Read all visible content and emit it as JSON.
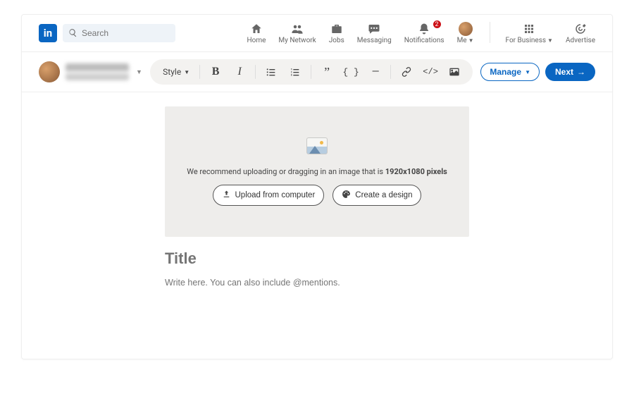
{
  "header": {
    "logo_text": "in",
    "search_placeholder": "Search",
    "nav": [
      {
        "key": "home",
        "label": "Home"
      },
      {
        "key": "network",
        "label": "My Network"
      },
      {
        "key": "jobs",
        "label": "Jobs"
      },
      {
        "key": "messaging",
        "label": "Messaging"
      },
      {
        "key": "notifications",
        "label": "Notifications",
        "badge": "2"
      },
      {
        "key": "me",
        "label": "Me",
        "dropdown": true
      },
      {
        "key": "business",
        "label": "For Business",
        "dropdown": true
      },
      {
        "key": "advertise",
        "label": "Advertise"
      }
    ]
  },
  "subbar": {
    "toolbar": {
      "style_label": "Style"
    },
    "manage_label": "Manage",
    "next_label": "Next"
  },
  "cover": {
    "recommend_prefix": "We recommend uploading or dragging in an image that is ",
    "recommend_bold": "1920x1080 pixels",
    "upload_label": "Upload from computer",
    "design_label": "Create a design"
  },
  "article": {
    "title_placeholder": "Title",
    "body_placeholder": "Write here. You can also include @mentions."
  }
}
